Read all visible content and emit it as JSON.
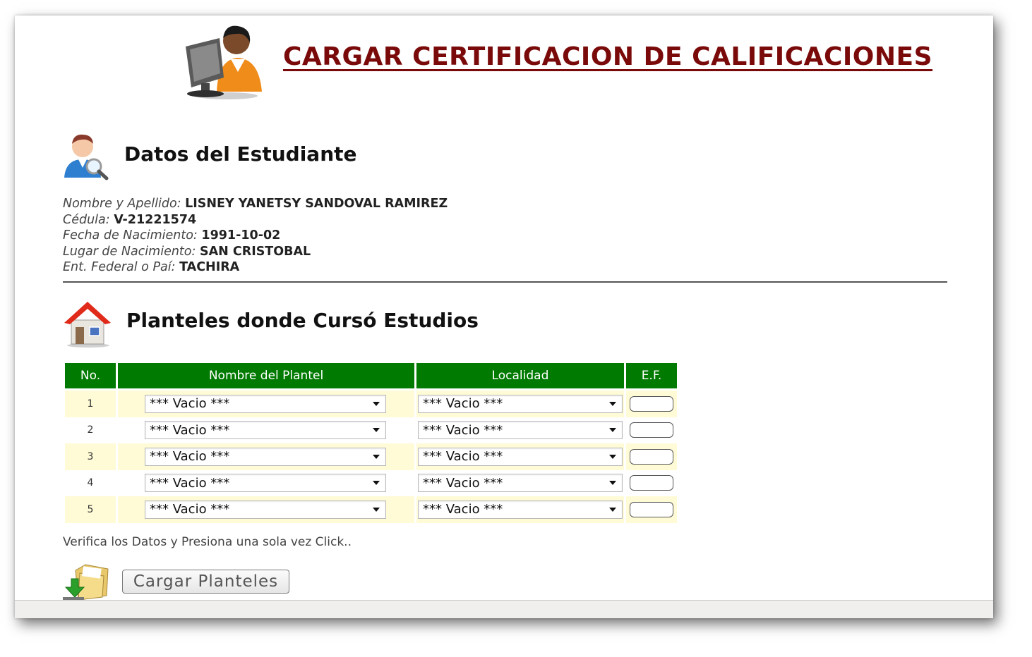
{
  "header": {
    "title": "CARGAR CERTIFICACION DE CALIFICACIONES"
  },
  "student_section": {
    "title": "Datos del Estudiante",
    "fields": [
      {
        "label": "Nombre y Apellido:",
        "value": "LISNEY YANETSY SANDOVAL RAMIREZ"
      },
      {
        "label": "Cédula:",
        "value": "V-21221574"
      },
      {
        "label": "Fecha de Nacimiento:",
        "value": "1991-10-02"
      },
      {
        "label": "Lugar de Nacimiento:",
        "value": "SAN CRISTOBAL"
      },
      {
        "label": "Ent. Federal o Paí:",
        "value": "TACHIRA"
      }
    ]
  },
  "schools_section": {
    "title": "Planteles donde Cursó Estudios",
    "columns": [
      "No.",
      "Nombre del Plantel",
      "Localidad",
      "E.F."
    ],
    "rows": [
      {
        "no": "1",
        "plantel": "*** Vacio ***",
        "localidad": "*** Vacio ***",
        "ef": ""
      },
      {
        "no": "2",
        "plantel": "*** Vacio ***",
        "localidad": "*** Vacio ***",
        "ef": ""
      },
      {
        "no": "3",
        "plantel": "*** Vacio ***",
        "localidad": "*** Vacio ***",
        "ef": ""
      },
      {
        "no": "4",
        "plantel": "*** Vacio ***",
        "localidad": "*** Vacio ***",
        "ef": ""
      },
      {
        "no": "5",
        "plantel": "*** Vacio ***",
        "localidad": "*** Vacio ***",
        "ef": ""
      }
    ]
  },
  "footer": {
    "note": "Verifica los Datos y Presiona una sola vez Click..",
    "button_label": "Cargar Planteles"
  },
  "colors": {
    "title": "#7a0a0a",
    "table_header": "#007a00",
    "row_alt": "#fffbd6"
  },
  "icons": [
    "computer-user-icon",
    "student-search-icon",
    "house-icon",
    "folder-download-icon",
    "dropdown-arrow-icon"
  ]
}
